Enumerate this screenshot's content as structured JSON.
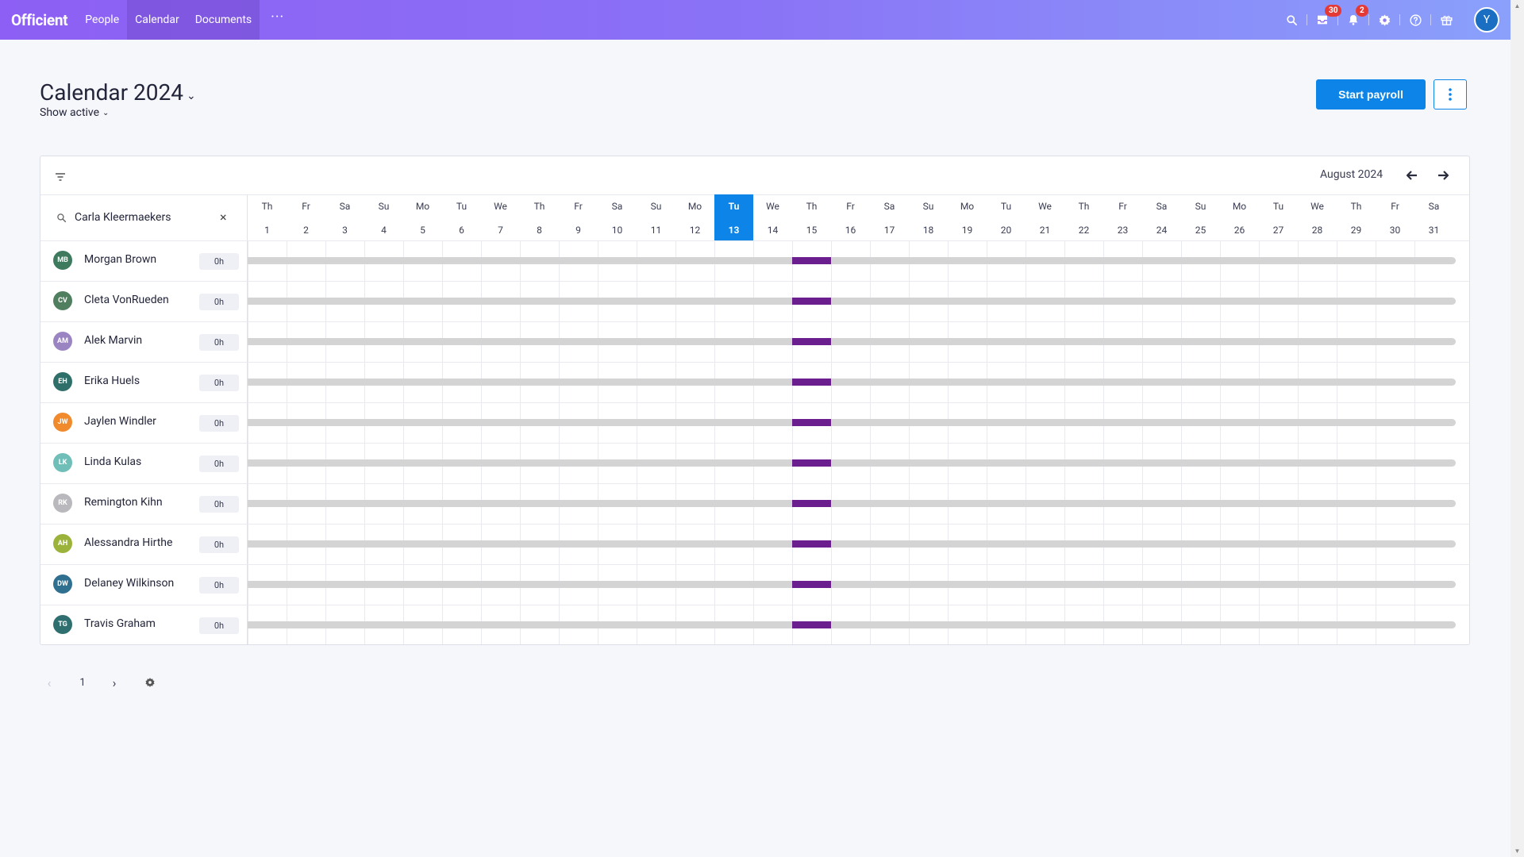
{
  "app": {
    "logo": "Officient",
    "nav": [
      {
        "label": "People"
      },
      {
        "label": "Calendar"
      },
      {
        "label": "Documents"
      }
    ],
    "more_label": "···",
    "badges": {
      "inbox": "30",
      "notifications": "2"
    },
    "user_initial": "Y"
  },
  "page": {
    "title": "Calendar 2024",
    "filter_label": "Show active",
    "primary_button": "Start payroll"
  },
  "calendar": {
    "month_label": "August 2024",
    "search_value": "Carla Kleermaekers",
    "today": 13,
    "days": [
      {
        "d": "Th",
        "n": "1"
      },
      {
        "d": "Fr",
        "n": "2"
      },
      {
        "d": "Sa",
        "n": "3"
      },
      {
        "d": "Su",
        "n": "4"
      },
      {
        "d": "Mo",
        "n": "5"
      },
      {
        "d": "Tu",
        "n": "6"
      },
      {
        "d": "We",
        "n": "7"
      },
      {
        "d": "Th",
        "n": "8"
      },
      {
        "d": "Fr",
        "n": "9"
      },
      {
        "d": "Sa",
        "n": "10"
      },
      {
        "d": "Su",
        "n": "11"
      },
      {
        "d": "Mo",
        "n": "12"
      },
      {
        "d": "Tu",
        "n": "13"
      },
      {
        "d": "We",
        "n": "14"
      },
      {
        "d": "Th",
        "n": "15"
      },
      {
        "d": "Fr",
        "n": "16"
      },
      {
        "d": "Sa",
        "n": "17"
      },
      {
        "d": "Su",
        "n": "18"
      },
      {
        "d": "Mo",
        "n": "19"
      },
      {
        "d": "Tu",
        "n": "20"
      },
      {
        "d": "We",
        "n": "21"
      },
      {
        "d": "Th",
        "n": "22"
      },
      {
        "d": "Fr",
        "n": "23"
      },
      {
        "d": "Sa",
        "n": "24"
      },
      {
        "d": "Su",
        "n": "25"
      },
      {
        "d": "Mo",
        "n": "26"
      },
      {
        "d": "Tu",
        "n": "27"
      },
      {
        "d": "We",
        "n": "28"
      },
      {
        "d": "Th",
        "n": "29"
      },
      {
        "d": "Fr",
        "n": "30"
      },
      {
        "d": "Sa",
        "n": "31"
      }
    ],
    "holiday_day": 15,
    "holiday_color": "#6b1f8f",
    "employees": [
      {
        "initials": "MB",
        "name": "Morgan Brown",
        "hours": "0h",
        "color": "#3d7a5e"
      },
      {
        "initials": "CV",
        "name": "Cleta VonRueden",
        "hours": "0h",
        "color": "#4f7f5f"
      },
      {
        "initials": "AM",
        "name": "Alek Marvin",
        "hours": "0h",
        "color": "#9a85c2"
      },
      {
        "initials": "EH",
        "name": "Erika Huels",
        "hours": "0h",
        "color": "#2f6f6a"
      },
      {
        "initials": "JW",
        "name": "Jaylen Windler",
        "hours": "0h",
        "color": "#f08a2c"
      },
      {
        "initials": "LK",
        "name": "Linda Kulas",
        "hours": "0h",
        "color": "#6fbfb8"
      },
      {
        "initials": "RK",
        "name": "Remington Kihn",
        "hours": "0h",
        "color": "#b9b9bd"
      },
      {
        "initials": "AH",
        "name": "Alessandra Hirthe",
        "hours": "0h",
        "color": "#9bb33a"
      },
      {
        "initials": "DW",
        "name": "Delaney Wilkinson",
        "hours": "0h",
        "color": "#2f6f8f"
      },
      {
        "initials": "TG",
        "name": "Travis Graham",
        "hours": "0h",
        "color": "#2f6f70"
      }
    ]
  },
  "pagination": {
    "current_page": "1"
  }
}
